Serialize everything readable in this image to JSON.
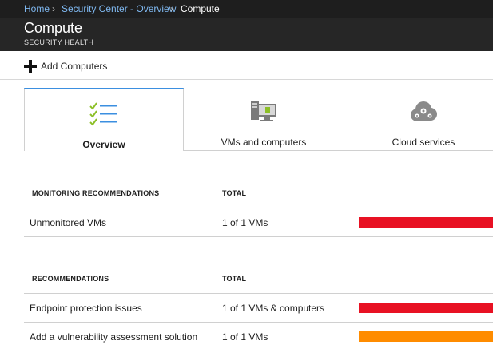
{
  "breadcrumb": {
    "items": [
      "Home",
      "Security Center - Overview",
      "Compute"
    ],
    "separator": "›"
  },
  "header": {
    "title": "Compute",
    "subtitle": "SECURITY HEALTH"
  },
  "toolbar": {
    "add_label": "Add Computers",
    "add_icon": "plus-icon"
  },
  "tiles": [
    {
      "label": "Overview",
      "icon": "checklist-icon",
      "active": true
    },
    {
      "label": "VMs and computers",
      "icon": "computers-icon",
      "active": false
    },
    {
      "label": "Cloud services",
      "icon": "cloud-gear-icon",
      "active": false
    }
  ],
  "monitoring": {
    "header_name": "MONITORING RECOMMENDATIONS",
    "header_total": "TOTAL",
    "rows": [
      {
        "name": "Unmonitored VMs",
        "total": "1 of 1 VMs",
        "severity_color": "#e81123",
        "fill": 1.0
      }
    ]
  },
  "recommendations": {
    "header_name": "RECOMMENDATIONS",
    "header_total": "TOTAL",
    "rows": [
      {
        "name": "Endpoint protection issues",
        "total": "1 of 1 VMs & computers",
        "severity_color": "#e81123",
        "fill": 1.0
      },
      {
        "name": "Add a vulnerability assessment solution",
        "total": "1 of 1 VMs",
        "severity_color": "#ff8c00",
        "fill": 1.0
      }
    ]
  },
  "colors": {
    "accent": "#3b8fe0",
    "link": "#7fb8f0",
    "high": "#e81123",
    "medium": "#ff8c00"
  }
}
